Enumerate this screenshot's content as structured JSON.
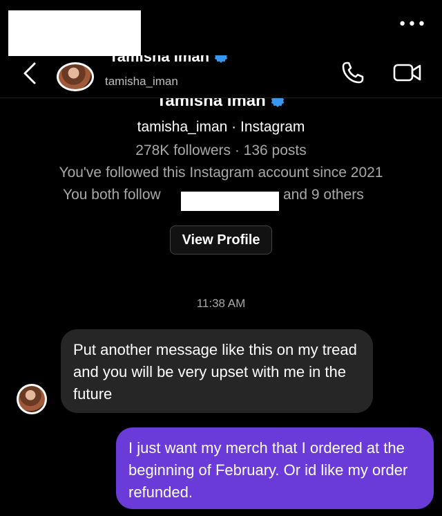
{
  "header": {
    "display_name": "Tamisha Iman",
    "username": "tamisha_iman"
  },
  "profile": {
    "name": "Tamisha Iman",
    "subtitle": "tamisha_iman · Instagram",
    "stats": "278K followers · 136 posts",
    "followed_since": "You've followed this Instagram account since 2021",
    "mutual_prefix": "You both follow",
    "mutual_suffix": "and 9 others",
    "view_profile_label": "View Profile"
  },
  "chat": {
    "timestamp": "11:38 AM",
    "messages": [
      {
        "sender": "them",
        "text": "Put another message like this on my tread and you will be very upset with me in the future"
      },
      {
        "sender": "me",
        "text": "I just want my merch that I ordered at the beginning of February. Or id like my order refunded."
      }
    ]
  },
  "colors": {
    "background": "#000000",
    "incoming_bubble": "#262626",
    "outgoing_bubble": "#6a3bd8",
    "verified_badge": "#3897f0",
    "muted_text": "#a8a8a8"
  },
  "icons": [
    "more-icon",
    "back-icon",
    "verified-icon",
    "phone-icon",
    "video-call-icon"
  ]
}
